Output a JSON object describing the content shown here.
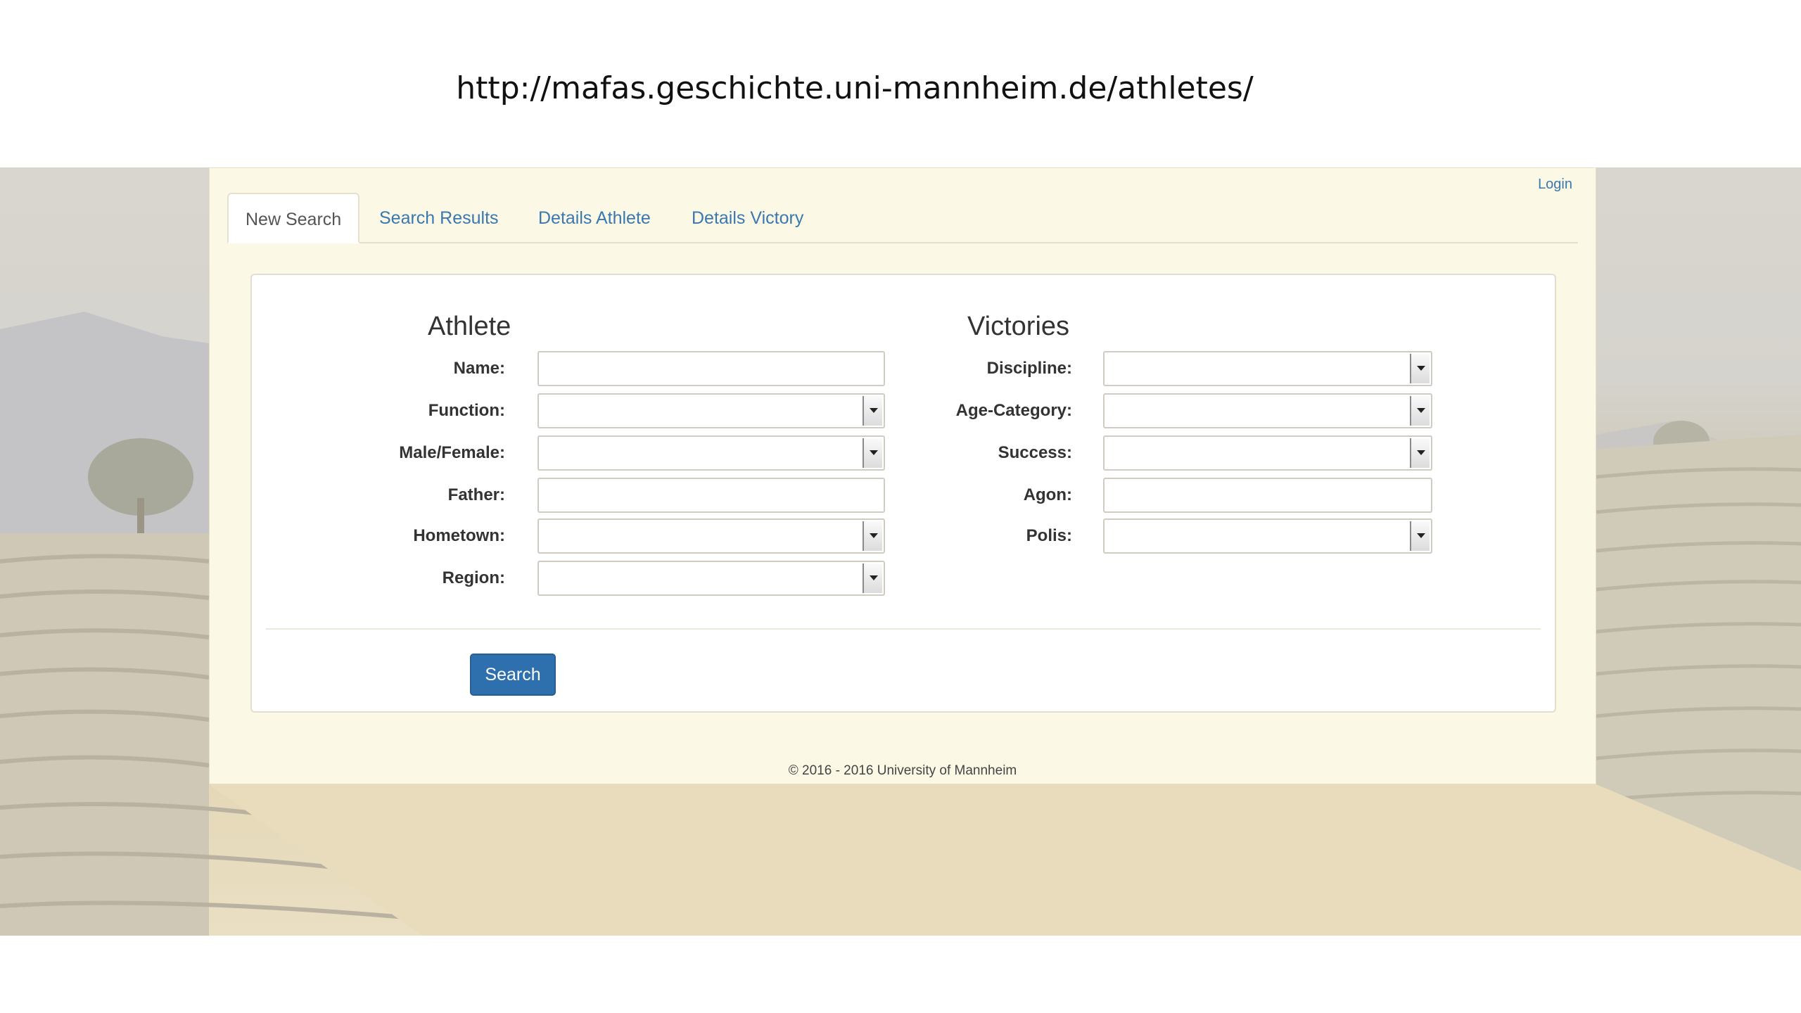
{
  "caption_url": "http://mafas.geschichte.uni-mannheim.de/athletes/",
  "header": {
    "login_label": "Login"
  },
  "tabs": [
    {
      "label": "New Search",
      "active": true
    },
    {
      "label": "Search Results",
      "active": false
    },
    {
      "label": "Details Athlete",
      "active": false
    },
    {
      "label": "Details Victory",
      "active": false
    }
  ],
  "athlete": {
    "title": "Athlete",
    "fields": [
      {
        "label": "Name:",
        "type": "text",
        "value": ""
      },
      {
        "label": "Function:",
        "type": "select",
        "value": ""
      },
      {
        "label": "Male/Female:",
        "type": "select",
        "value": ""
      },
      {
        "label": "Father:",
        "type": "text",
        "value": ""
      },
      {
        "label": "Hometown:",
        "type": "select",
        "value": ""
      },
      {
        "label": "Region:",
        "type": "select",
        "value": ""
      }
    ]
  },
  "victories": {
    "title": "Victories",
    "fields": [
      {
        "label": "Discipline:",
        "type": "select",
        "value": ""
      },
      {
        "label": "Age-Category:",
        "type": "select",
        "value": ""
      },
      {
        "label": "Success:",
        "type": "select",
        "value": ""
      },
      {
        "label": "Agon:",
        "type": "text",
        "value": ""
      },
      {
        "label": "Polis:",
        "type": "select",
        "value": ""
      }
    ]
  },
  "actions": {
    "search_label": "Search"
  },
  "footer": {
    "copyright": "© 2016 - 2016 University of Mannheim"
  },
  "colors": {
    "link": "#3a78b0",
    "primary_button": "#2e6fad",
    "panel_background": "#fcf8e6"
  }
}
